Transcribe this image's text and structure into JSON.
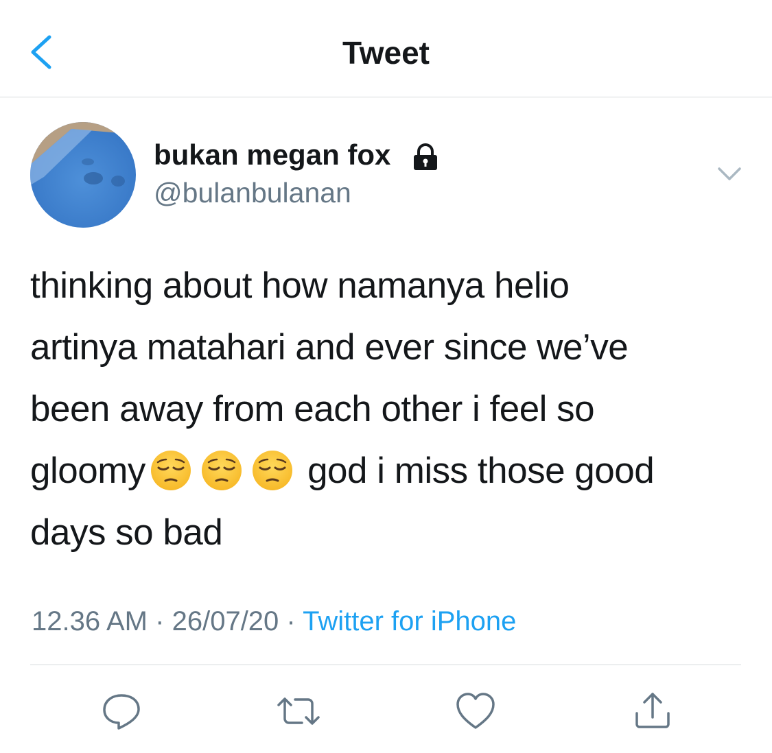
{
  "header": {
    "title": "Tweet"
  },
  "tweet": {
    "display_name": "bukan megan fox",
    "handle": "@bulanbulanan",
    "text_parts": {
      "part1": "thinking about how namanya helio\nartinya matahari and ever since we’ve\nbeen away from each other i feel so\ngloomy",
      "part2": " god i miss those good\ndays so bad"
    },
    "emoji": [
      "pensive-face",
      "pensive-face",
      "pensive-face"
    ],
    "time": "12.36 AM",
    "date": "26/07/20",
    "separator": "·",
    "source": "Twitter for iPhone"
  },
  "colors": {
    "accent": "#1da1f2",
    "text": "#14171a",
    "secondary": "#657786",
    "divider": "#d6d9dc"
  },
  "icons": {
    "back": "chevron-left-icon",
    "lock": "lock-icon",
    "more": "chevron-down-icon",
    "reply": "reply-icon",
    "retweet": "retweet-icon",
    "like": "heart-icon",
    "share": "share-icon"
  }
}
